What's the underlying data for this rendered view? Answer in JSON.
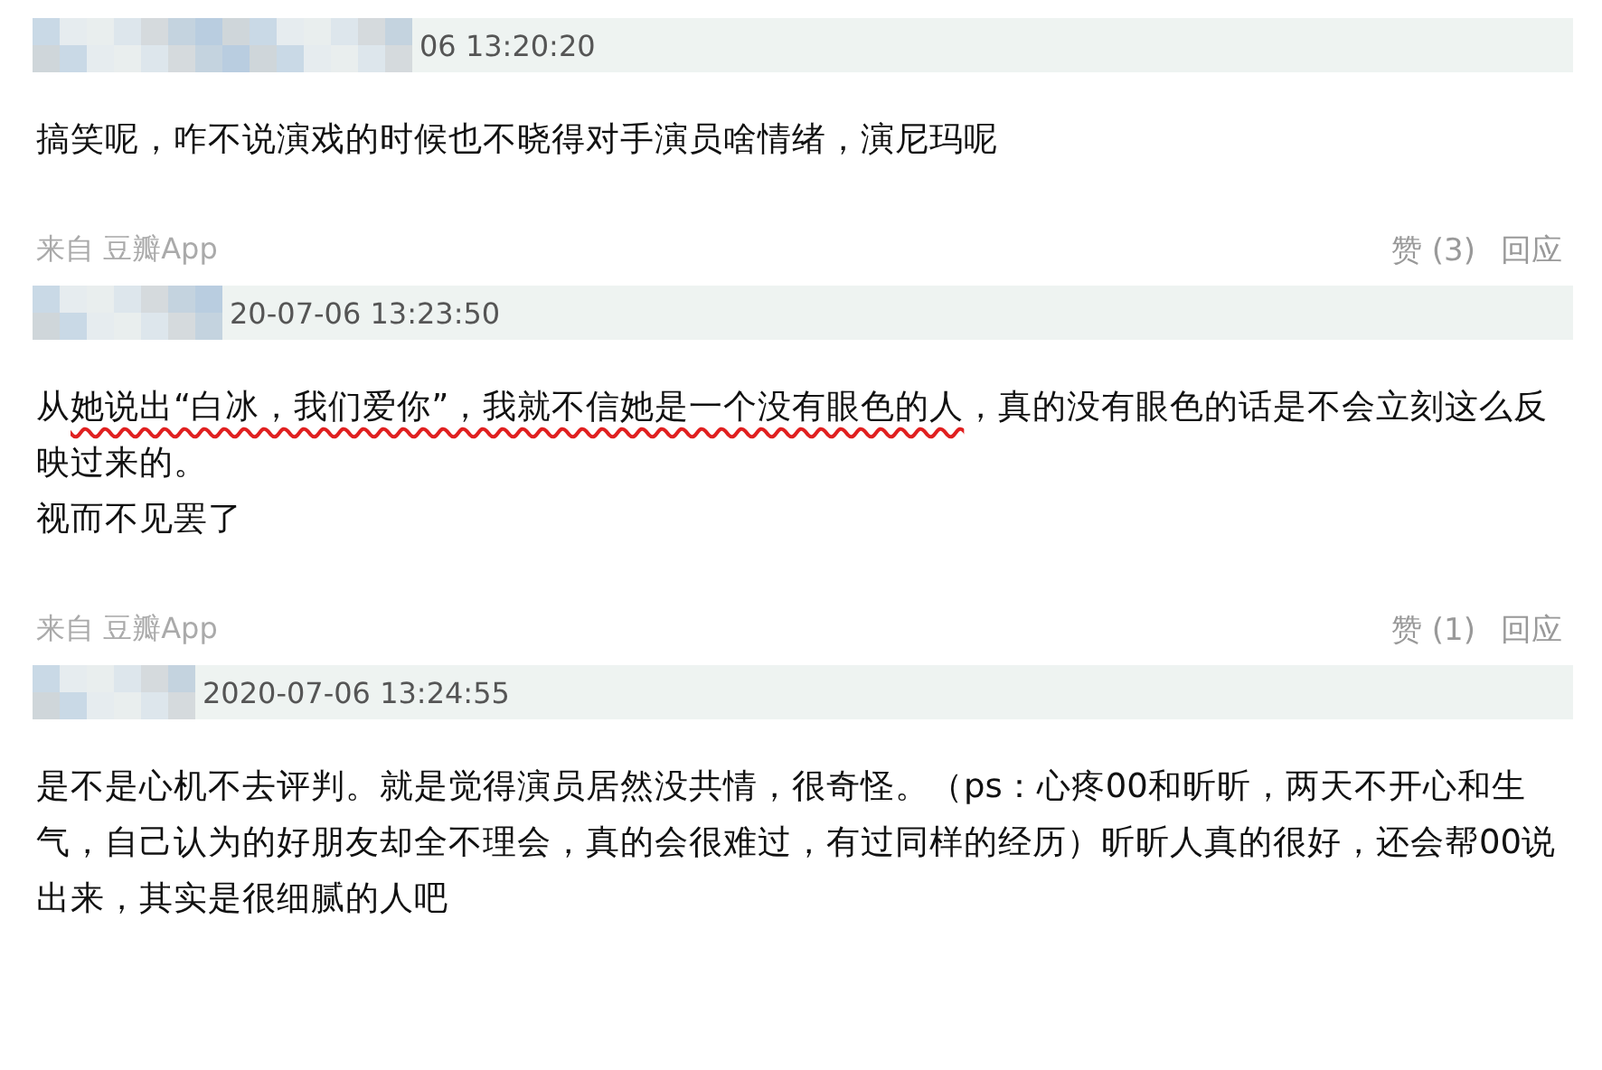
{
  "comments": [
    {
      "time": "06 13:20:20",
      "paragraphs": [
        [
          {
            "text": "搞笑呢，咋不说演戏的时候也不晓得对手演员啥情绪，演尼玛呢",
            "underlined": false
          }
        ]
      ],
      "footer": {
        "source": "来自 豆瓣App",
        "likes": "赞 (3)",
        "reply": "回应"
      }
    },
    {
      "time": "20-07-06 13:23:50",
      "paragraphs": [
        [
          {
            "text": "从",
            "underlined": false
          },
          {
            "text": "她说出“白冰，我们爱你”，我就不信她是一个没有眼色的人",
            "underlined": true
          },
          {
            "text": "，真的没有眼色的话是不会立刻这么反映过来的。",
            "underlined": false
          }
        ],
        [
          {
            "text": "视而不见罢了",
            "underlined": false
          }
        ]
      ],
      "footer": {
        "source": "来自 豆瓣App",
        "likes": "赞 (1)",
        "reply": "回应"
      }
    },
    {
      "time": "2020-07-06 13:24:55",
      "paragraphs": [
        [
          {
            "text": "是不是心机不去评判。就是觉得演员居然没共情，很奇怪。（ps：心疼00和昕昕，两天不开心和生气，自己认为的好朋友却全不理会，真的会很难过，有过同样的经历）昕昕人真的很好，还会帮00说出来，其实是很细腻的人吧",
            "underlined": false
          }
        ]
      ]
    }
  ]
}
